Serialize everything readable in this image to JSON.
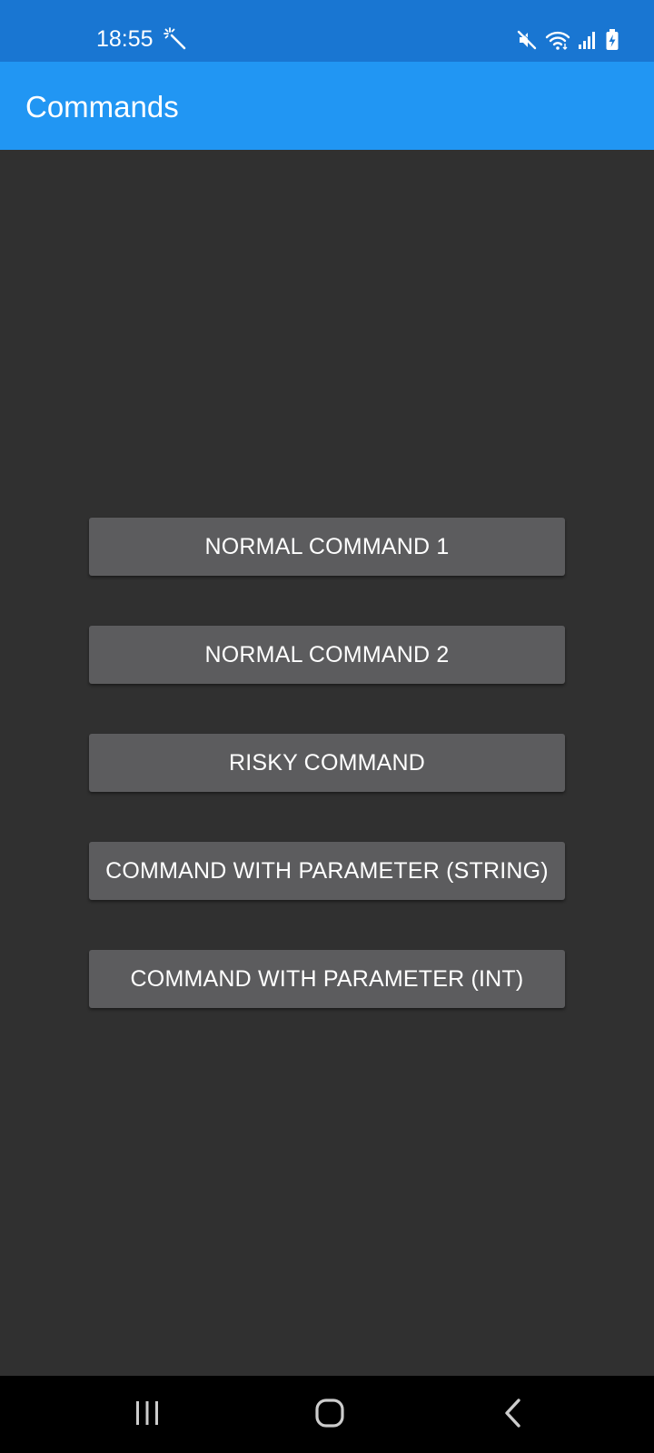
{
  "status_bar": {
    "time": "18:55",
    "icons": [
      "magic-wand-icon",
      "mute-icon",
      "wifi-icon",
      "signal-icon",
      "battery-charging-icon"
    ]
  },
  "app_bar": {
    "title": "Commands",
    "color": "#2196F3",
    "status_color": "#1976D2"
  },
  "buttons": [
    {
      "label": "NORMAL COMMAND 1"
    },
    {
      "label": "NORMAL COMMAND 2"
    },
    {
      "label": "RISKY COMMAND"
    },
    {
      "label": "COMMAND WITH PARAMETER (STRING)"
    },
    {
      "label": "COMMAND WITH PARAMETER (INT)"
    }
  ],
  "nav_bar": {
    "icons": [
      "recent-apps-icon",
      "home-icon",
      "back-icon"
    ]
  },
  "colors": {
    "background": "#303030",
    "button": "#5C5C5E",
    "button_text": "#FFFFFF"
  }
}
